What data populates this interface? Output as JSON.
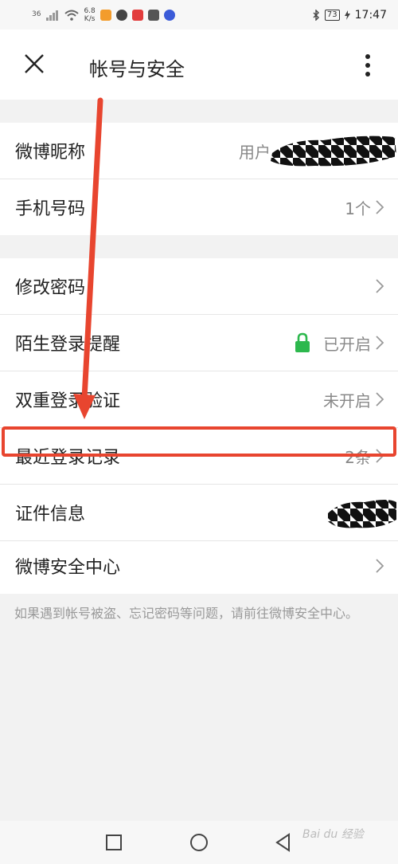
{
  "status_bar": {
    "signal": "36",
    "speed_value": "6.8",
    "speed_unit": "K/s",
    "battery": "73",
    "time": "17:47"
  },
  "header": {
    "title": "帐号与安全"
  },
  "group1": [
    {
      "label": "微博昵称",
      "value": "用户"
    },
    {
      "label": "手机号码",
      "value": "1个"
    }
  ],
  "group2": [
    {
      "label": "修改密码",
      "value": ""
    },
    {
      "label": "陌生登录提醒",
      "value": "已开启"
    },
    {
      "label": "双重登录验证",
      "value": "未开启"
    },
    {
      "label": "最近登录记录",
      "value": "2条"
    },
    {
      "label": "证件信息",
      "value": ""
    },
    {
      "label": "微博安全中心",
      "value": ""
    }
  ],
  "footnote": "如果遇到帐号被盗、忘记密码等问题，请前往微博安全中心。",
  "watermark": "Bai du 经验",
  "colors": {
    "accent_red": "#e8452f",
    "lock_green": "#2db84d"
  },
  "icons": {
    "close": "close-icon",
    "more": "more-vertical-icon",
    "chevron": "chevron-right-icon",
    "lock": "lock-icon"
  }
}
